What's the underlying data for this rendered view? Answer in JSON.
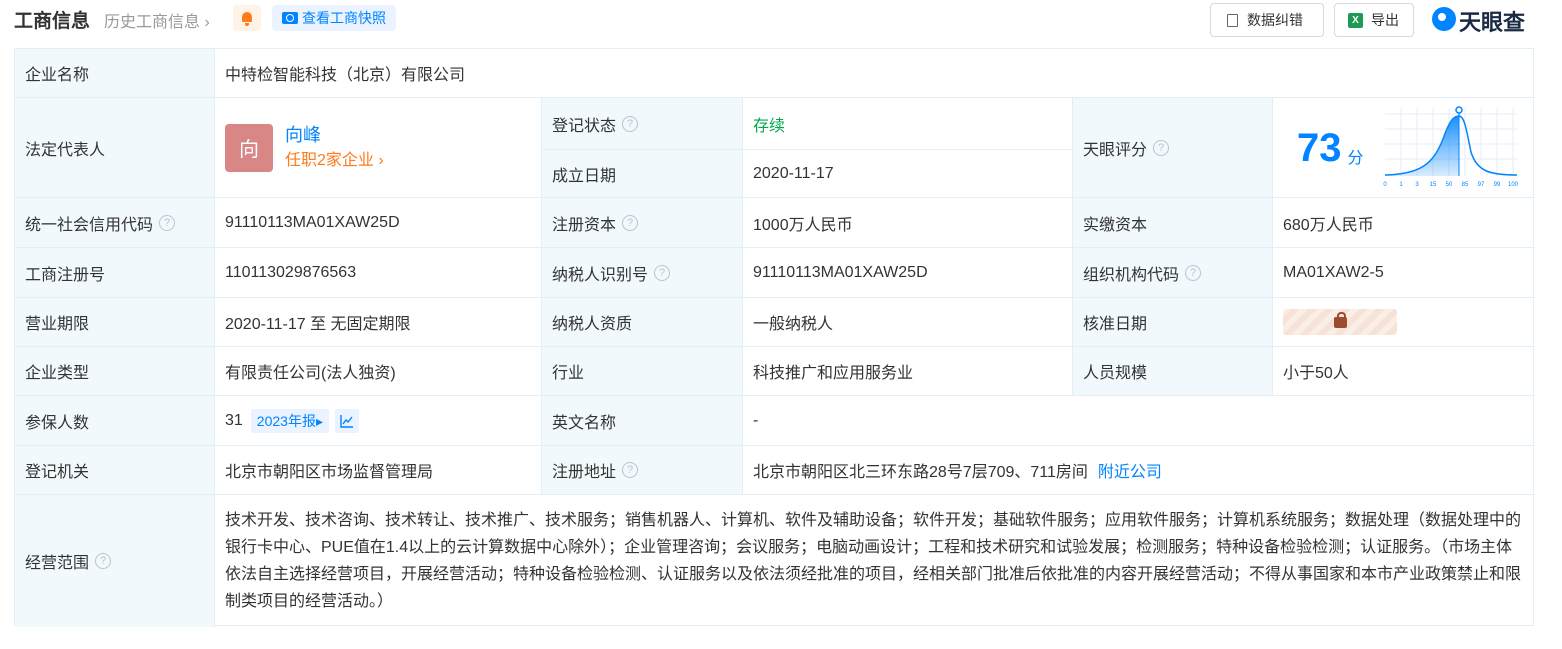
{
  "header": {
    "title": "工商信息",
    "history": "历史工商信息",
    "snapshot": "查看工商快照",
    "correct": "数据纠错",
    "export": "导出",
    "export_icon": "X",
    "logo": "天眼查"
  },
  "colors": {
    "accent": "#0084ff",
    "status_green": "#00a84f",
    "orange": "#ff7a1a",
    "label_bg": "#f2f9fc"
  },
  "company": {
    "name_label": "企业名称",
    "name": "中特检智能科技（北京）有限公司",
    "rep_label": "法定代表人",
    "rep_avatar": "向",
    "rep_name": "向峰",
    "rep_jobs": "任职2家企业",
    "status_label": "登记状态",
    "status": "存续",
    "founded_label": "成立日期",
    "founded": "2020-11-17",
    "score_label": "天眼评分",
    "score": "73",
    "score_unit": "分",
    "score_axis": [
      "0",
      "1",
      "3",
      "15",
      "50",
      "85",
      "97",
      "99",
      "100"
    ],
    "credit_label": "统一社会信用代码",
    "credit": "91110113MA01XAW25D",
    "capital_label": "注册资本",
    "capital": "1000万人民币",
    "paid_label": "实缴资本",
    "paid": "680万人民币",
    "regno_label": "工商注册号",
    "regno": "110113029876563",
    "taxid_label": "纳税人识别号",
    "taxid": "91110113MA01XAW25D",
    "orgcode_label": "组织机构代码",
    "orgcode": "MA01XAW2-5",
    "term_label": "营业期限",
    "term": "2020-11-17 至 无固定期限",
    "taxqual_label": "纳税人资质",
    "taxqual": "一般纳税人",
    "approve_label": "核准日期",
    "type_label": "企业类型",
    "type": "有限责任公司(法人独资)",
    "industry_label": "行业",
    "industry": "科技推广和应用服务业",
    "staff_label": "人员规模",
    "staff": "小于50人",
    "insured_label": "参保人数",
    "insured": "31",
    "insured_report": "2023年报",
    "en_label": "英文名称",
    "en": "-",
    "authority_label": "登记机关",
    "authority": "北京市朝阳区市场监督管理局",
    "address_label": "注册地址",
    "address": "北京市朝阳区北三环东路28号7层709、711房间",
    "nearby": "附近公司",
    "scope_label": "经营范围",
    "scope": "技术开发、技术咨询、技术转让、技术推广、技术服务；销售机器人、计算机、软件及辅助设备；软件开发；基础软件服务；应用软件服务；计算机系统服务；数据处理（数据处理中的银行卡中心、PUE值在1.4以上的云计算数据中心除外）；企业管理咨询；会议服务；电脑动画设计；工程和技术研究和试验发展；检测服务；特种设备检验检测；认证服务。（市场主体依法自主选择经营项目，开展经营活动；特种设备检验检测、认证服务以及依法须经批准的项目，经相关部门批准后依批准的内容开展经营活动；不得从事国家和本市产业政策禁止和限制类项目的经营活动。）"
  }
}
